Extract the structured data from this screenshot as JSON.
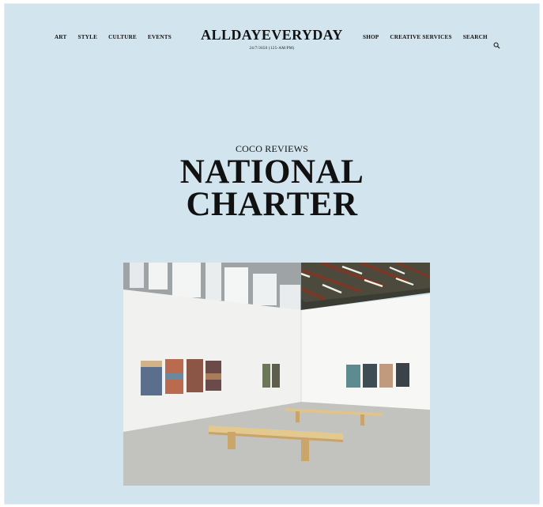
{
  "site": {
    "logo": "ALLDAYEVERYDAY",
    "tagline": "24/7/3650 (125-AM/PM)",
    "nav_left": [
      "ART",
      "STYLE",
      "CULTURE",
      "EVENTS"
    ],
    "nav_right": [
      "SHOP",
      "CREATIVE SERVICES",
      "SEARCH"
    ]
  },
  "article": {
    "kicker": "COCO REVIEWS",
    "title": "NATIONAL\nCHARTER"
  },
  "colors": {
    "background": "#d2e5ee",
    "text": "#111111"
  },
  "icons": {
    "search": "search-icon"
  }
}
